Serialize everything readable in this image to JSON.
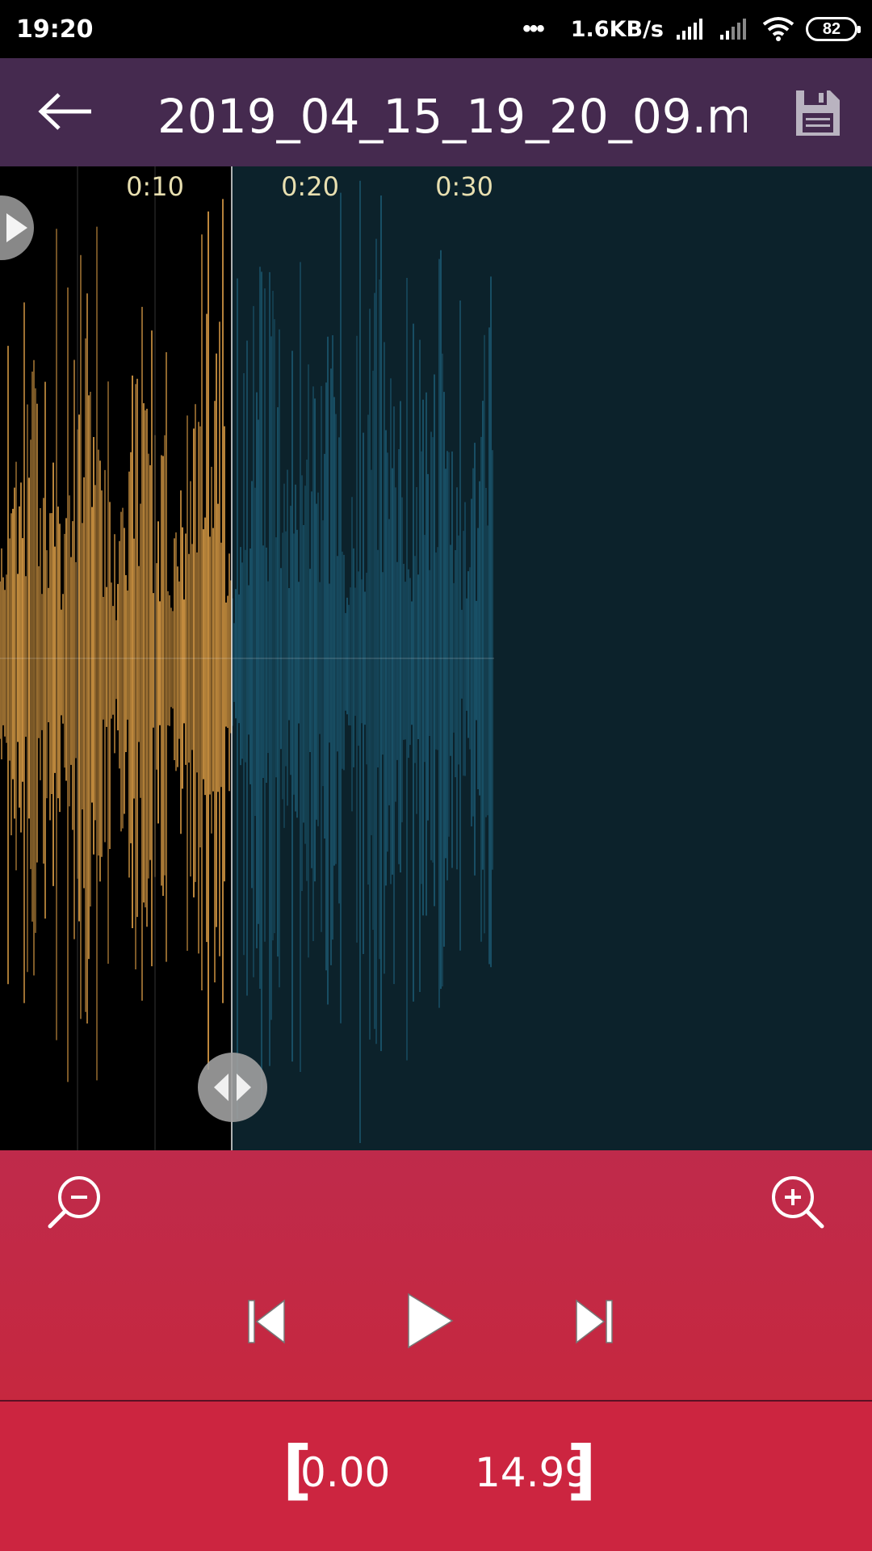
{
  "status_bar": {
    "time": "19:20",
    "dots": "•••",
    "net_speed": "1.6KB/s",
    "battery": "82"
  },
  "header": {
    "title": "2019_04_15_19_20_09.m...",
    "back_icon": "arrow-left-icon",
    "save_icon": "floppy-disk-icon"
  },
  "waveform": {
    "time_labels": [
      "0:10",
      "0:20",
      "0:30"
    ],
    "selected_color": "#f6b04e",
    "unselected_color": "#1d5d77",
    "background_color": "#0c222b",
    "selection_background_color": "#000000"
  },
  "controls": {
    "zoom_out_icon": "zoom-out-icon",
    "zoom_in_icon": "zoom-in-icon",
    "prev_icon": "skip-previous-icon",
    "play_icon": "play-icon",
    "next_icon": "skip-next-icon"
  },
  "range": {
    "open_bracket": "[",
    "start": "0.00",
    "end": "14.99",
    "close_bracket": "]"
  }
}
